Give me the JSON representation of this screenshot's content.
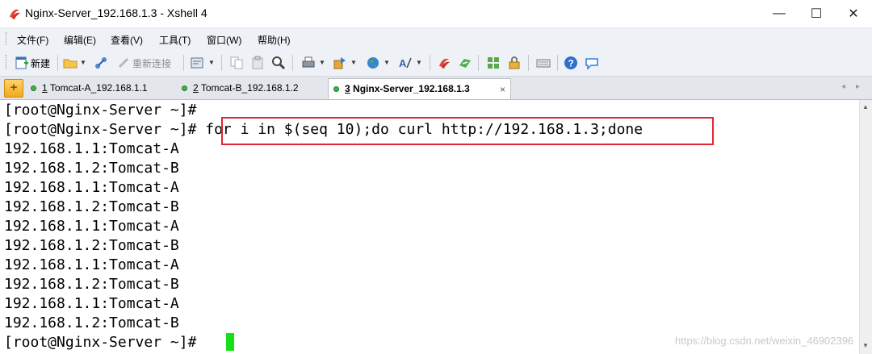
{
  "window": {
    "title": "Nginx-Server_192.168.1.3 - Xshell 4",
    "controls": {
      "minimize": "—",
      "maximize": "☐",
      "close": "✕"
    }
  },
  "menu": [
    "文件(F)",
    "编辑(E)",
    "查看(V)",
    "工具(T)",
    "窗口(W)",
    "帮助(H)"
  ],
  "toolbar": {
    "new_label": "新建",
    "reconnect_label": "重新连接"
  },
  "tabs": [
    {
      "number": "1",
      "label": "Tomcat-A_192.168.1.1",
      "status_color": "#3db34a",
      "active": false
    },
    {
      "number": "2",
      "label": "Tomcat-B_192.168.1.2",
      "status_color": "#3db34a",
      "active": false
    },
    {
      "number": "3",
      "label": "Nginx-Server_192.168.1.3",
      "status_color": "#3db34a",
      "active": true,
      "close": "×"
    }
  ],
  "tab_nav": {
    "prev": "◂",
    "next": "▸",
    "add": "+"
  },
  "terminal": {
    "lines": [
      "[root@Nginx-Server ~]#",
      "[root@Nginx-Server ~]# for i in $(seq 10);do curl http://192.168.1.3;done",
      "192.168.1.1:Tomcat-A",
      "192.168.1.2:Tomcat-B",
      "192.168.1.1:Tomcat-A",
      "192.168.1.2:Tomcat-B",
      "192.168.1.1:Tomcat-A",
      "192.168.1.2:Tomcat-B",
      "192.168.1.1:Tomcat-A",
      "192.168.1.2:Tomcat-B",
      "192.168.1.1:Tomcat-A",
      "192.168.1.2:Tomcat-B",
      "[root@Nginx-Server ~]# "
    ],
    "highlight_color": "#e0282c",
    "cursor_color": "#14e01a"
  },
  "scrollbar": {
    "up": "▲",
    "down": "▼"
  },
  "watermark": "https://blog.csdn.net/weixin_46902396"
}
